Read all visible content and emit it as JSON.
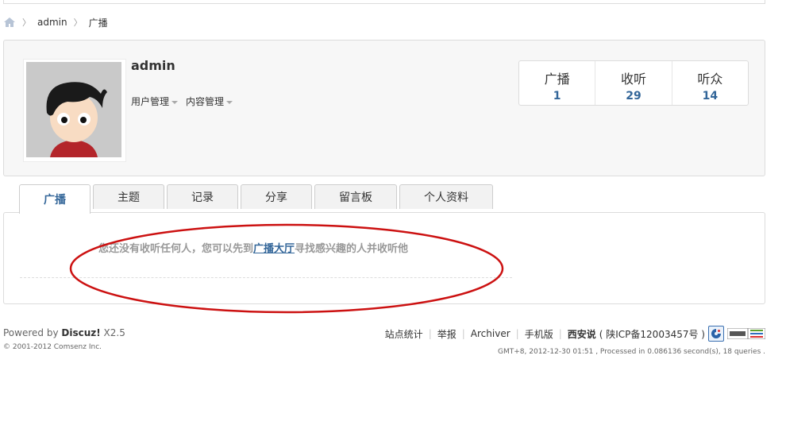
{
  "breadcrumb": {
    "items": [
      "admin",
      "广播"
    ]
  },
  "profile": {
    "username": "admin",
    "menus": [
      "用户管理",
      "内容管理"
    ],
    "stats": [
      {
        "label": "广播",
        "value": "1"
      },
      {
        "label": "收听",
        "value": "29"
      },
      {
        "label": "听众",
        "value": "14"
      }
    ]
  },
  "tabs": [
    "广播",
    "主题",
    "记录",
    "分享",
    "留言板",
    "个人资料"
  ],
  "content": {
    "msg_before": "您还没有收听任何人，您可以先到",
    "msg_link": "广播大厅",
    "msg_after": "寻找感兴趣的人并收听他"
  },
  "footer": {
    "powered_prefix": "Powered by ",
    "brand": "Discuz!",
    "version": " X2.5",
    "copyright": "© 2001-2012 Comsenz Inc.",
    "links": [
      "站点统计",
      "举报",
      "Archiver",
      "手机版",
      "西安说"
    ],
    "icp": "( 陕ICP备12003457号 )",
    "processed": "GMT+8, 2012-12-30 01:51 , Processed in 0.086136 second(s), 18 queries ."
  },
  "colors": {
    "link": "#336699",
    "annotation": "#cc1111"
  }
}
